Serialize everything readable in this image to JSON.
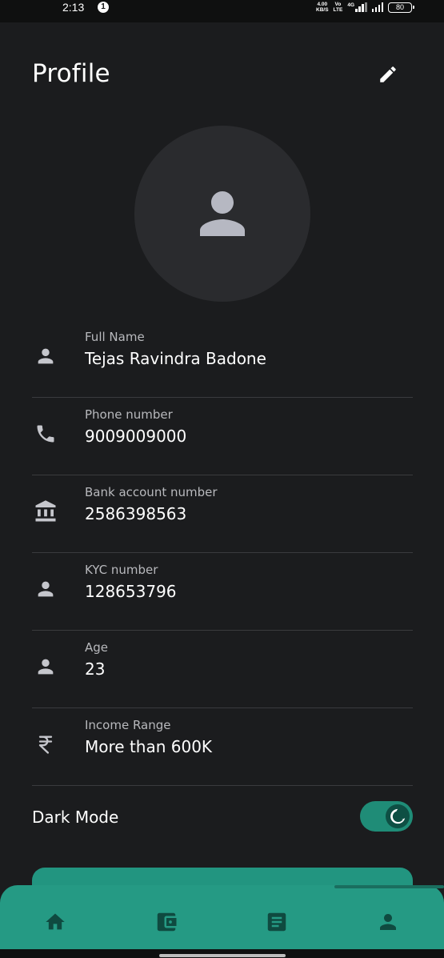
{
  "status_bar": {
    "time": "2:13",
    "notification_badge": "1",
    "net_speed_value": "4.00",
    "net_speed_unit": "KB/S",
    "volte_top": "Vo",
    "volte_bottom": "LTE",
    "network_type": "4G",
    "battery": "80"
  },
  "header": {
    "title": "Profile",
    "edit_icon": "pencil-icon"
  },
  "avatar": {
    "icon": "person-icon"
  },
  "fields": [
    {
      "icon": "person-icon",
      "label": "Full Name",
      "value": "Tejas Ravindra Badone"
    },
    {
      "icon": "phone-icon",
      "label": "Phone number",
      "value": "9009009000"
    },
    {
      "icon": "bank-icon",
      "label": "Bank account number",
      "value": "2586398563"
    },
    {
      "icon": "person-icon",
      "label": "KYC number",
      "value": "128653796"
    },
    {
      "icon": "person-icon",
      "label": "Age",
      "value": "23"
    },
    {
      "icon": "rupee-icon",
      "label": "Income Range",
      "value": "More than 600K"
    }
  ],
  "dark_mode": {
    "label": "Dark Mode",
    "enabled": true,
    "icon": "moon-icon"
  },
  "bottom_nav": {
    "items": [
      {
        "icon": "home-icon",
        "active": false
      },
      {
        "icon": "wallet-icon",
        "active": false
      },
      {
        "icon": "document-icon",
        "active": false
      },
      {
        "icon": "person-icon",
        "active": true
      }
    ]
  },
  "colors": {
    "background": "#1b1c1e",
    "accent": "#259a84",
    "icon_gray": "#c5c6cc",
    "nav_icon": "#0f4a40"
  }
}
